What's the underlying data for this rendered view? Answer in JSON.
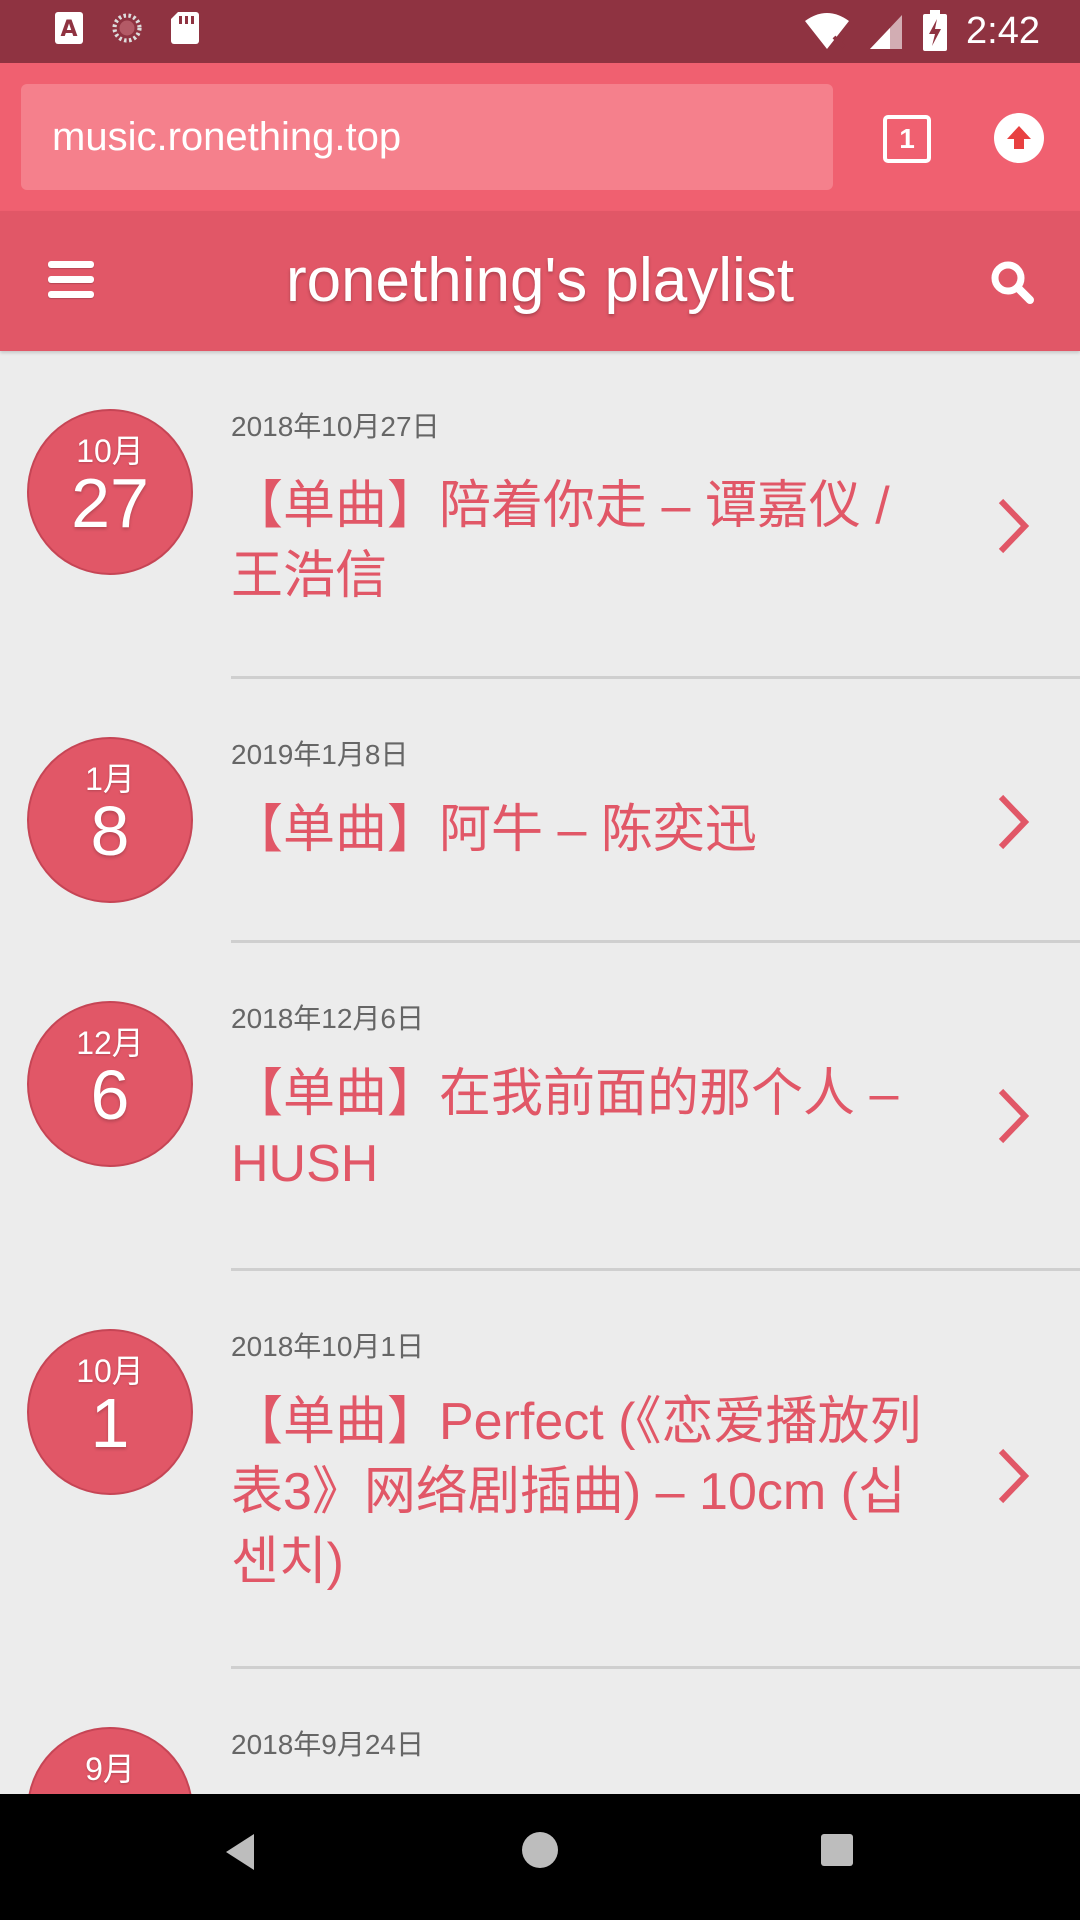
{
  "status_bar": {
    "time": "2:42",
    "icons": [
      "font-a-icon",
      "loading-icon",
      "sd-card-icon",
      "wifi-icon",
      "signal-icon",
      "battery-charging-icon"
    ]
  },
  "browser": {
    "url": "music.ronething.top",
    "tab_count": "1"
  },
  "header": {
    "title": "ronething's playlist"
  },
  "colors": {
    "accent": "#e15767",
    "status_bar": "#8f3341",
    "browser_bar": "#f06070"
  },
  "items": [
    {
      "month": "10月",
      "day": "27",
      "date": "2018年10月27日",
      "title": "【单曲】陪着你走 – 谭嘉仪 / 王浩信"
    },
    {
      "month": "1月",
      "day": "8",
      "date": "2019年1月8日",
      "title": "【单曲】阿牛 – 陈奕迅"
    },
    {
      "month": "12月",
      "day": "6",
      "date": "2018年12月6日",
      "title": "【单曲】在我前面的那个人 – HUSH"
    },
    {
      "month": "10月",
      "day": "1",
      "date": "2018年10月1日",
      "title": "【单曲】Perfect (《恋爱播放列表3》网络剧插曲) – 10cm (십센치)"
    },
    {
      "month": "9月",
      "date": "2018年9月24日"
    }
  ]
}
